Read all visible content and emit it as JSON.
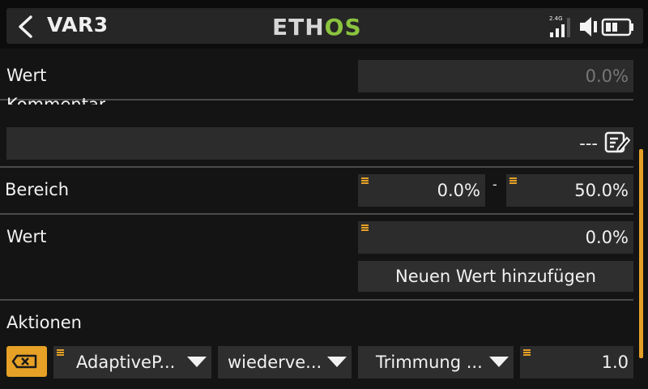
{
  "header": {
    "title": "VAR3",
    "logo_left": "ETH",
    "logo_right": "OS",
    "logo_colors": {
      "white": "#d6d6d6",
      "green": "#8bc43f"
    },
    "signal_band": "2.4G"
  },
  "rows": {
    "wert_top": {
      "label": "Wert",
      "value": "0.0%"
    },
    "kommentar": {
      "label": "Kommentar",
      "value": "---"
    },
    "bereich": {
      "label": "Bereich",
      "min": "0.0%",
      "separator": "-",
      "max": "50.0%"
    },
    "wert": {
      "label": "Wert",
      "value": "0.0%",
      "add_button": "Neuen Wert hinzufügen"
    },
    "aktionen": {
      "label": "Aktionen",
      "source": "AdaptiveP...",
      "mode": "wiederve...",
      "target": "Trimmung ...",
      "amount": "1.0"
    }
  },
  "accent_color": "#e6a126"
}
